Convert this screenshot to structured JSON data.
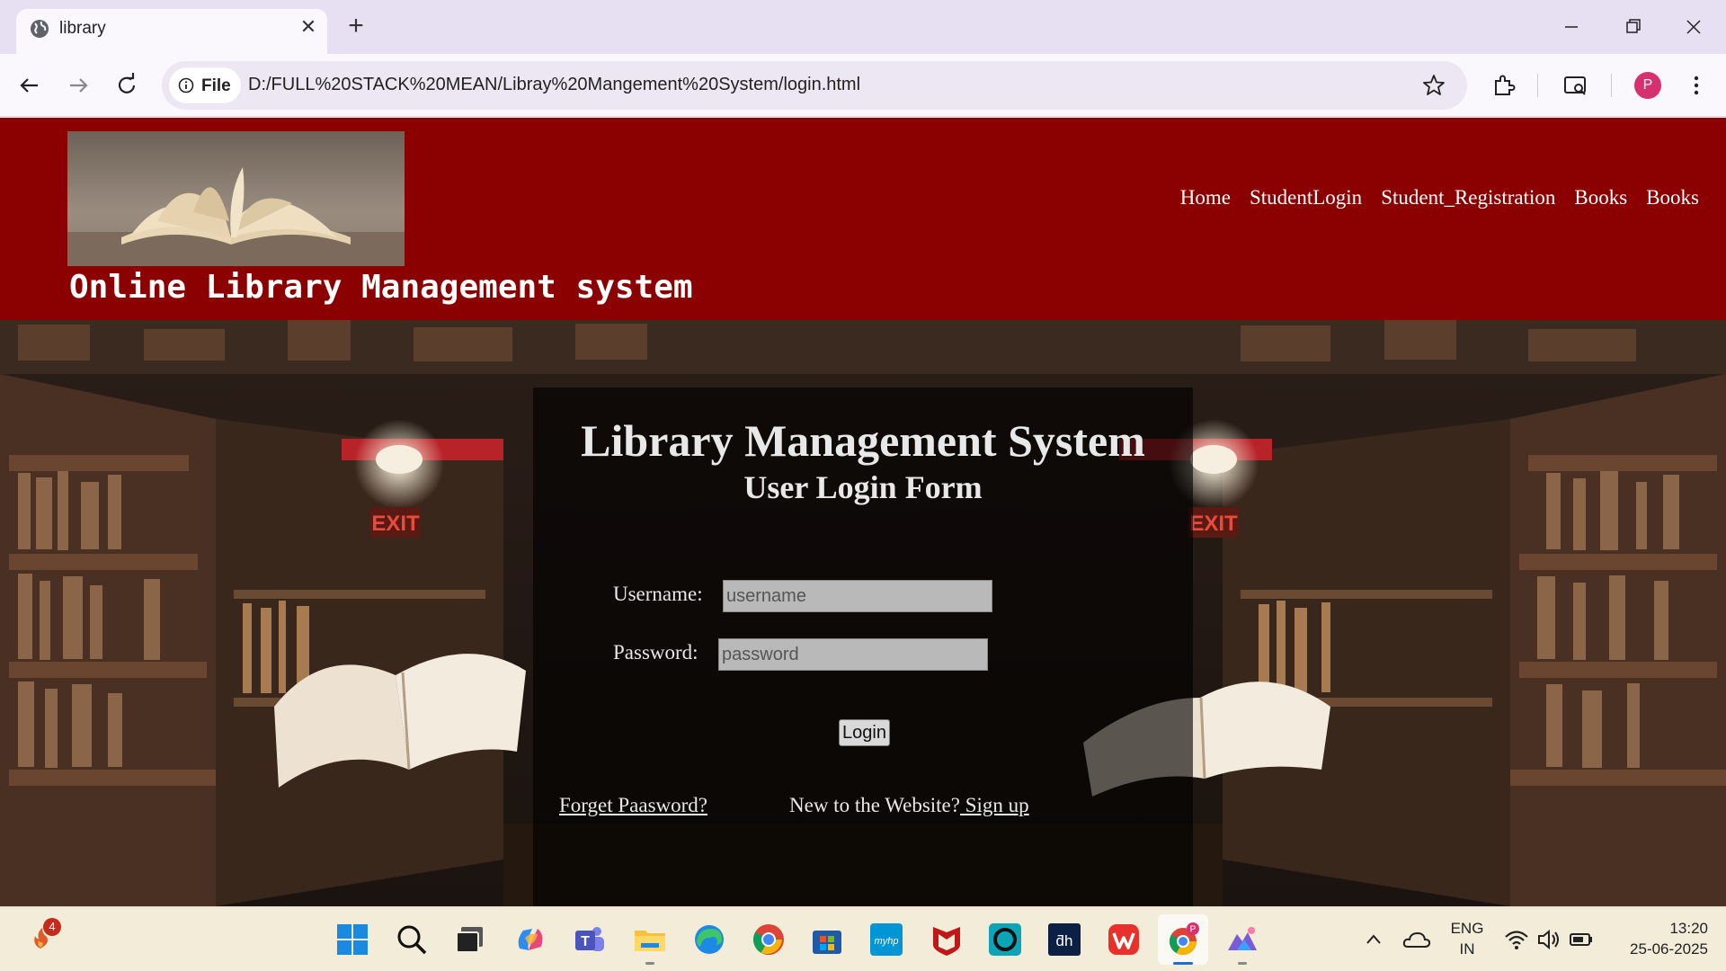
{
  "browser": {
    "tab_title": "library",
    "file_chip": "File",
    "url": "D:/FULL%20STACK%20MEAN/Libray%20Mangement%20System/login.html",
    "profile_initial": "P"
  },
  "site": {
    "title": "Online Library Management system",
    "nav": [
      "Home",
      "StudentLogin",
      "Student_Registration",
      "Books",
      "Books"
    ]
  },
  "login": {
    "heading": "Library Management System",
    "subheading": "User Login Form",
    "username_label": "Username:",
    "username_placeholder": "username",
    "password_label": "Password:",
    "password_placeholder": "password",
    "login_button": "Login",
    "forgot_link": "Forget Paasword?",
    "new_user_text": "New to the Website?",
    "signup_link": " Sign up"
  },
  "taskbar": {
    "weather_badge": "4",
    "language_top": "ENG",
    "language_bottom": "IN",
    "time": "13:20",
    "date": "25-06-2025",
    "icons": [
      "windows-start",
      "search",
      "task-view",
      "copilot",
      "teams",
      "file-explorer",
      "edge",
      "chrome",
      "microsoft-store",
      "myhp",
      "mcafee",
      "alexa",
      "dh",
      "wps-office",
      "chrome-profile",
      "photos"
    ]
  },
  "colors": {
    "header_bg": "#8b0000",
    "login_box": "rgba(0,0,0,0.62)",
    "avatar": "#d6316f"
  }
}
